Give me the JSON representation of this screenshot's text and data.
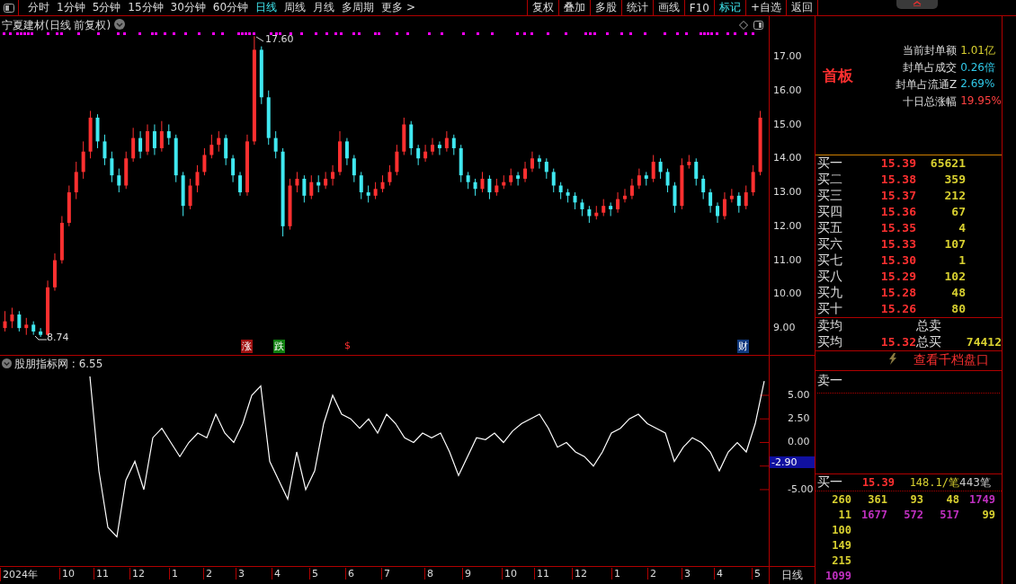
{
  "toolbar": {
    "periods": [
      {
        "label": "分时",
        "selected": false
      },
      {
        "label": "1分钟",
        "selected": false
      },
      {
        "label": "5分钟",
        "selected": false
      },
      {
        "label": "15分钟",
        "selected": false
      },
      {
        "label": "30分钟",
        "selected": false
      },
      {
        "label": "60分钟",
        "selected": false
      },
      {
        "label": "日线",
        "selected": true
      },
      {
        "label": "周线",
        "selected": false
      },
      {
        "label": "月线",
        "selected": false
      },
      {
        "label": "多周期",
        "selected": false
      },
      {
        "label": "更多 >",
        "selected": false
      }
    ],
    "buttons": [
      {
        "label": "复权",
        "selected": false
      },
      {
        "label": "叠加",
        "selected": false
      },
      {
        "label": "多股",
        "selected": false
      },
      {
        "label": "统计",
        "selected": false
      },
      {
        "label": "画线",
        "selected": false
      },
      {
        "label": "F10",
        "selected": false
      },
      {
        "label": "标记",
        "selected": true
      },
      {
        "label": "+自选",
        "selected": false
      },
      {
        "label": "返回",
        "selected": false
      }
    ]
  },
  "price_chart": {
    "title": "宁夏建材(日线 前复权)",
    "high_label": "17.60",
    "low_label": "8.74",
    "chart_data": {
      "type": "candlestick",
      "yticks": [
        {
          "value": 17,
          "label": "17.00"
        },
        {
          "value": 16,
          "label": "16.00"
        },
        {
          "value": 15,
          "label": "15.00"
        },
        {
          "value": 14,
          "label": "14.00"
        },
        {
          "value": 13,
          "label": "13.00"
        },
        {
          "value": 12,
          "label": "12.00"
        },
        {
          "value": 11,
          "label": "11.00"
        },
        {
          "value": 10,
          "label": "10.00"
        },
        {
          "value": 9,
          "label": "9.00"
        }
      ],
      "ylim": [
        8.21,
        18.19
      ],
      "categories": [
        null,
        null,
        null,
        null,
        null,
        null,
        null,
        null,
        null,
        null,
        null,
        null,
        null,
        null,
        null,
        null,
        null,
        null,
        null,
        null,
        null,
        null,
        null,
        null,
        null,
        null,
        null,
        null,
        null,
        null,
        null,
        null,
        null,
        null,
        null,
        null,
        null,
        null,
        null,
        null,
        null,
        null,
        null,
        null,
        null,
        null,
        null,
        null,
        null,
        null,
        null,
        null,
        null,
        null,
        null,
        null,
        null,
        null,
        null,
        null,
        null,
        null,
        null,
        null,
        null,
        null,
        null,
        null,
        null,
        null,
        null,
        null,
        null,
        null,
        null,
        null,
        null,
        null,
        null,
        null,
        null,
        null,
        null,
        null,
        null,
        null,
        null,
        null,
        null,
        null,
        null,
        null,
        null,
        null,
        null,
        null,
        null,
        null,
        null,
        null,
        null,
        null,
        null,
        null,
        null,
        null,
        null
      ],
      "ohlc": [
        [
          9.0,
          9.5,
          8.9,
          9.2
        ],
        [
          9.2,
          9.6,
          9.0,
          9.4
        ],
        [
          9.4,
          9.5,
          8.9,
          9.0
        ],
        [
          9.0,
          9.3,
          8.8,
          9.1
        ],
        [
          9.1,
          9.2,
          8.8,
          8.9
        ],
        [
          8.9,
          9.0,
          8.74,
          8.8
        ],
        [
          8.8,
          10.4,
          8.8,
          10.2
        ],
        [
          10.2,
          11.2,
          10.1,
          11.0
        ],
        [
          11.0,
          12.3,
          10.9,
          12.1
        ],
        [
          12.1,
          13.2,
          12.0,
          13.0
        ],
        [
          13.0,
          13.9,
          12.8,
          13.6
        ],
        [
          13.6,
          14.5,
          13.4,
          14.2
        ],
        [
          14.2,
          15.4,
          14.0,
          15.2
        ],
        [
          15.2,
          15.3,
          14.3,
          14.5
        ],
        [
          14.5,
          14.7,
          13.8,
          14.0
        ],
        [
          14.0,
          14.2,
          13.3,
          13.5
        ],
        [
          13.5,
          13.7,
          13.0,
          13.2
        ],
        [
          13.2,
          14.2,
          13.1,
          14.0
        ],
        [
          14.0,
          14.9,
          13.9,
          14.6
        ],
        [
          14.6,
          14.8,
          14.0,
          14.2
        ],
        [
          14.2,
          15.0,
          14.1,
          14.8
        ],
        [
          14.8,
          15.0,
          14.1,
          14.3
        ],
        [
          14.3,
          15.1,
          14.2,
          14.8
        ],
        [
          14.8,
          15.0,
          14.4,
          14.6
        ],
        [
          14.6,
          14.7,
          13.3,
          13.5
        ],
        [
          13.5,
          13.6,
          12.3,
          12.6
        ],
        [
          12.6,
          13.4,
          12.5,
          13.2
        ],
        [
          13.2,
          13.8,
          13.0,
          13.6
        ],
        [
          13.6,
          14.3,
          13.5,
          14.1
        ],
        [
          14.1,
          14.7,
          14.0,
          14.4
        ],
        [
          14.4,
          14.8,
          14.2,
          14.6
        ],
        [
          14.6,
          14.7,
          13.8,
          14.0
        ],
        [
          14.0,
          14.1,
          13.3,
          13.5
        ],
        [
          13.5,
          13.6,
          12.9,
          13.0
        ],
        [
          13.0,
          14.7,
          12.9,
          14.5
        ],
        [
          14.5,
          17.6,
          14.4,
          17.2
        ],
        [
          17.2,
          17.3,
          15.6,
          15.8
        ],
        [
          15.8,
          16.0,
          14.4,
          14.6
        ],
        [
          14.6,
          14.8,
          14.0,
          14.2
        ],
        [
          14.2,
          14.3,
          11.7,
          12.0
        ],
        [
          12.0,
          13.4,
          11.9,
          13.2
        ],
        [
          13.2,
          13.6,
          13.0,
          13.4
        ],
        [
          13.4,
          13.5,
          12.7,
          12.9
        ],
        [
          12.9,
          13.5,
          12.8,
          13.3
        ],
        [
          13.3,
          13.5,
          13.0,
          13.2
        ],
        [
          13.2,
          13.6,
          13.1,
          13.4
        ],
        [
          13.4,
          13.8,
          13.2,
          13.6
        ],
        [
          13.6,
          14.8,
          13.5,
          14.5
        ],
        [
          14.5,
          14.6,
          13.8,
          14.0
        ],
        [
          14.0,
          14.1,
          13.3,
          13.5
        ],
        [
          13.5,
          13.6,
          12.8,
          13.0
        ],
        [
          13.0,
          13.2,
          12.7,
          12.9
        ],
        [
          12.9,
          13.3,
          12.8,
          13.1
        ],
        [
          13.1,
          13.5,
          13.0,
          13.3
        ],
        [
          13.3,
          13.8,
          13.2,
          13.6
        ],
        [
          13.6,
          14.4,
          13.5,
          14.2
        ],
        [
          14.2,
          15.2,
          14.1,
          15.0
        ],
        [
          15.0,
          15.1,
          14.1,
          14.3
        ],
        [
          14.3,
          14.4,
          13.8,
          14.0
        ],
        [
          14.0,
          14.4,
          13.9,
          14.2
        ],
        [
          14.2,
          14.6,
          14.1,
          14.4
        ],
        [
          14.4,
          14.5,
          14.1,
          14.3
        ],
        [
          14.3,
          14.8,
          14.2,
          14.6
        ],
        [
          14.6,
          14.7,
          14.1,
          14.3
        ],
        [
          14.3,
          14.4,
          13.3,
          13.5
        ],
        [
          13.5,
          13.6,
          13.1,
          13.3
        ],
        [
          13.3,
          13.4,
          12.9,
          13.1
        ],
        [
          13.1,
          13.6,
          13.0,
          13.4
        ],
        [
          13.4,
          13.5,
          12.8,
          13.0
        ],
        [
          13.0,
          13.4,
          12.9,
          13.2
        ],
        [
          13.2,
          13.5,
          13.1,
          13.3
        ],
        [
          13.3,
          13.7,
          13.2,
          13.5
        ],
        [
          13.5,
          13.6,
          13.2,
          13.4
        ],
        [
          13.4,
          13.9,
          13.3,
          13.7
        ],
        [
          13.7,
          14.2,
          13.6,
          14.0
        ],
        [
          14.0,
          14.1,
          13.7,
          13.9
        ],
        [
          13.9,
          14.0,
          13.4,
          13.6
        ],
        [
          13.6,
          13.7,
          13.0,
          13.2
        ],
        [
          13.2,
          13.3,
          12.8,
          13.0
        ],
        [
          13.0,
          13.1,
          12.7,
          12.9
        ],
        [
          12.9,
          13.0,
          12.5,
          12.7
        ],
        [
          12.7,
          12.8,
          12.3,
          12.5
        ],
        [
          12.5,
          12.6,
          12.1,
          12.3
        ],
        [
          12.3,
          12.6,
          12.2,
          12.4
        ],
        [
          12.4,
          12.8,
          12.3,
          12.6
        ],
        [
          12.6,
          12.7,
          12.3,
          12.5
        ],
        [
          12.5,
          13.0,
          12.4,
          12.8
        ],
        [
          12.8,
          13.1,
          12.7,
          12.9
        ],
        [
          12.9,
          13.4,
          12.8,
          13.2
        ],
        [
          13.2,
          13.7,
          13.1,
          13.5
        ],
        [
          13.5,
          13.6,
          13.2,
          13.4
        ],
        [
          13.4,
          14.1,
          13.3,
          13.9
        ],
        [
          13.9,
          14.0,
          13.4,
          13.6
        ],
        [
          13.6,
          13.7,
          13.0,
          13.2
        ],
        [
          13.2,
          13.3,
          12.4,
          12.6
        ],
        [
          12.6,
          14.0,
          12.5,
          13.8
        ],
        [
          13.8,
          14.1,
          13.7,
          13.9
        ],
        [
          13.9,
          14.0,
          13.2,
          13.4
        ],
        [
          13.4,
          13.5,
          12.8,
          13.0
        ],
        [
          13.0,
          13.1,
          12.4,
          12.6
        ],
        [
          12.6,
          12.7,
          12.1,
          12.3
        ],
        [
          12.3,
          13.0,
          12.2,
          12.8
        ],
        [
          12.8,
          13.1,
          12.7,
          12.9
        ],
        [
          12.9,
          13.0,
          12.4,
          12.6
        ],
        [
          12.6,
          13.2,
          12.5,
          13.0
        ],
        [
          13.0,
          13.8,
          12.9,
          13.6
        ],
        [
          13.6,
          15.4,
          13.5,
          15.2
        ]
      ]
    },
    "signals": [
      {
        "text": "涨",
        "color": "#a01010"
      },
      {
        "text": "跌",
        "color": "#108010"
      },
      {
        "text": "$",
        "color": "#000000"
      },
      {
        "text": "财",
        "color": "#103a80"
      }
    ]
  },
  "indicator": {
    "title": "股朋指标网 : 6.55",
    "current": "-2.90",
    "chart_data": {
      "type": "line",
      "ylim": [
        -13.1,
        9.19
      ],
      "categories": [
        null,
        null,
        null,
        null,
        null,
        null,
        null,
        null,
        null,
        null,
        null,
        null,
        null,
        null,
        null,
        null,
        null,
        null,
        null,
        null,
        null,
        null,
        null,
        null,
        null,
        null,
        null,
        null,
        null,
        null,
        null,
        null,
        null,
        null,
        null,
        null,
        null,
        null,
        null,
        null,
        null,
        null,
        null,
        null,
        null,
        null,
        null,
        null,
        null,
        null,
        null,
        null,
        null,
        null,
        null,
        null,
        null,
        null,
        null,
        null,
        null,
        null,
        null,
        null,
        null,
        null,
        null,
        null,
        null,
        null,
        null,
        null,
        null,
        null,
        null,
        null
      ],
      "yticks": [
        {
          "value": 5,
          "label": "5.00"
        },
        {
          "value": 2.5,
          "label": "2.50"
        },
        {
          "value": 0,
          "label": "0.00"
        },
        {
          "value": -5,
          "label": "-5.00"
        }
      ],
      "series": [
        {
          "color": "#ffffff",
          "values": [
            7,
            -3,
            -9,
            -10,
            -4,
            -2,
            -5,
            0.5,
            1.5,
            0,
            -1.5,
            0,
            1,
            0.5,
            3,
            1,
            0,
            2,
            5,
            6,
            -2,
            -4,
            -6,
            -1,
            -5,
            -3,
            2,
            5,
            3,
            2.5,
            1.5,
            2.5,
            1,
            3,
            2,
            0.5,
            0,
            1,
            0.5,
            1,
            -1,
            -3.5,
            -1.5,
            0.5,
            0.3,
            1,
            0,
            1.2,
            2,
            2.5,
            3,
            1.5,
            -0.5,
            0,
            -1,
            -1.5,
            -2.5,
            -1,
            1,
            1.5,
            2.5,
            3,
            2,
            1.5,
            1,
            -2,
            -0.5,
            0.5,
            0,
            -1,
            -3,
            -1,
            0,
            -1,
            2,
            6.5
          ]
        }
      ]
    }
  },
  "time_axis": {
    "labels": [
      "2024年",
      "10",
      "11",
      "12",
      "1",
      "2",
      "3",
      "4",
      "5",
      "6",
      "7",
      "8",
      "9",
      "10",
      "11",
      "12",
      "1",
      "2",
      "3",
      "4",
      "5"
    ],
    "period": "日线"
  },
  "quote": {
    "board": "首板",
    "stats": [
      {
        "label": "当前封单额",
        "value": "1.01亿",
        "color": "#d8d030"
      },
      {
        "label": "封单占成交",
        "value": "0.26倍",
        "color": "#30c8e8"
      },
      {
        "label": "封单占流通Z",
        "value": "2.69%",
        "color": "#30c8e8"
      },
      {
        "label": "十日总涨幅",
        "value": "19.95%",
        "color": "#ff4040"
      }
    ],
    "bids": [
      {
        "label": "买一",
        "price": "15.39",
        "volume": "65621"
      },
      {
        "label": "买二",
        "price": "15.38",
        "volume": "359"
      },
      {
        "label": "买三",
        "price": "15.37",
        "volume": "212"
      },
      {
        "label": "买四",
        "price": "15.36",
        "volume": "67"
      },
      {
        "label": "买五",
        "price": "15.35",
        "volume": "4"
      },
      {
        "label": "买六",
        "price": "15.33",
        "volume": "107"
      },
      {
        "label": "买七",
        "price": "15.30",
        "volume": "1"
      },
      {
        "label": "买八",
        "price": "15.29",
        "volume": "102"
      },
      {
        "label": "买九",
        "price": "15.28",
        "volume": "48"
      },
      {
        "label": "买十",
        "price": "15.26",
        "volume": "80"
      }
    ],
    "summary": [
      {
        "label": "卖均",
        "total_label": "总卖"
      },
      {
        "label": "买均",
        "price": "15.32",
        "total_label": "总买",
        "total": "74412"
      }
    ],
    "depth_button": "查看千档盘口",
    "ask_label": "卖一",
    "queue_head": {
      "label": "买一",
      "price": "15.39",
      "average": "148.1/笔",
      "count": "443笔"
    },
    "queue": [
      [
        {
          "text": "260",
          "color": "#d8d030"
        },
        {
          "text": "361",
          "color": "#d8d030"
        },
        {
          "text": "93",
          "color": "#d8d030"
        },
        {
          "text": "48",
          "color": "#d8d030"
        },
        {
          "text": "1749",
          "color": "#c030c0"
        }
      ],
      [
        {
          "text": "11",
          "color": "#d8d030"
        },
        {
          "text": "1677",
          "color": "#c030c0"
        },
        {
          "text": "572",
          "color": "#c030c0"
        },
        {
          "text": "517",
          "color": "#c030c0"
        },
        {
          "text": "99",
          "color": "#d8d030"
        }
      ],
      [
        {
          "text": "100",
          "color": "#d8d030"
        }
      ],
      [
        {
          "text": "149",
          "color": "#d8d030"
        }
      ],
      [
        {
          "text": "215",
          "color": "#d8d030"
        }
      ],
      [
        {
          "text": "1099",
          "color": "#c030c0"
        }
      ]
    ]
  }
}
